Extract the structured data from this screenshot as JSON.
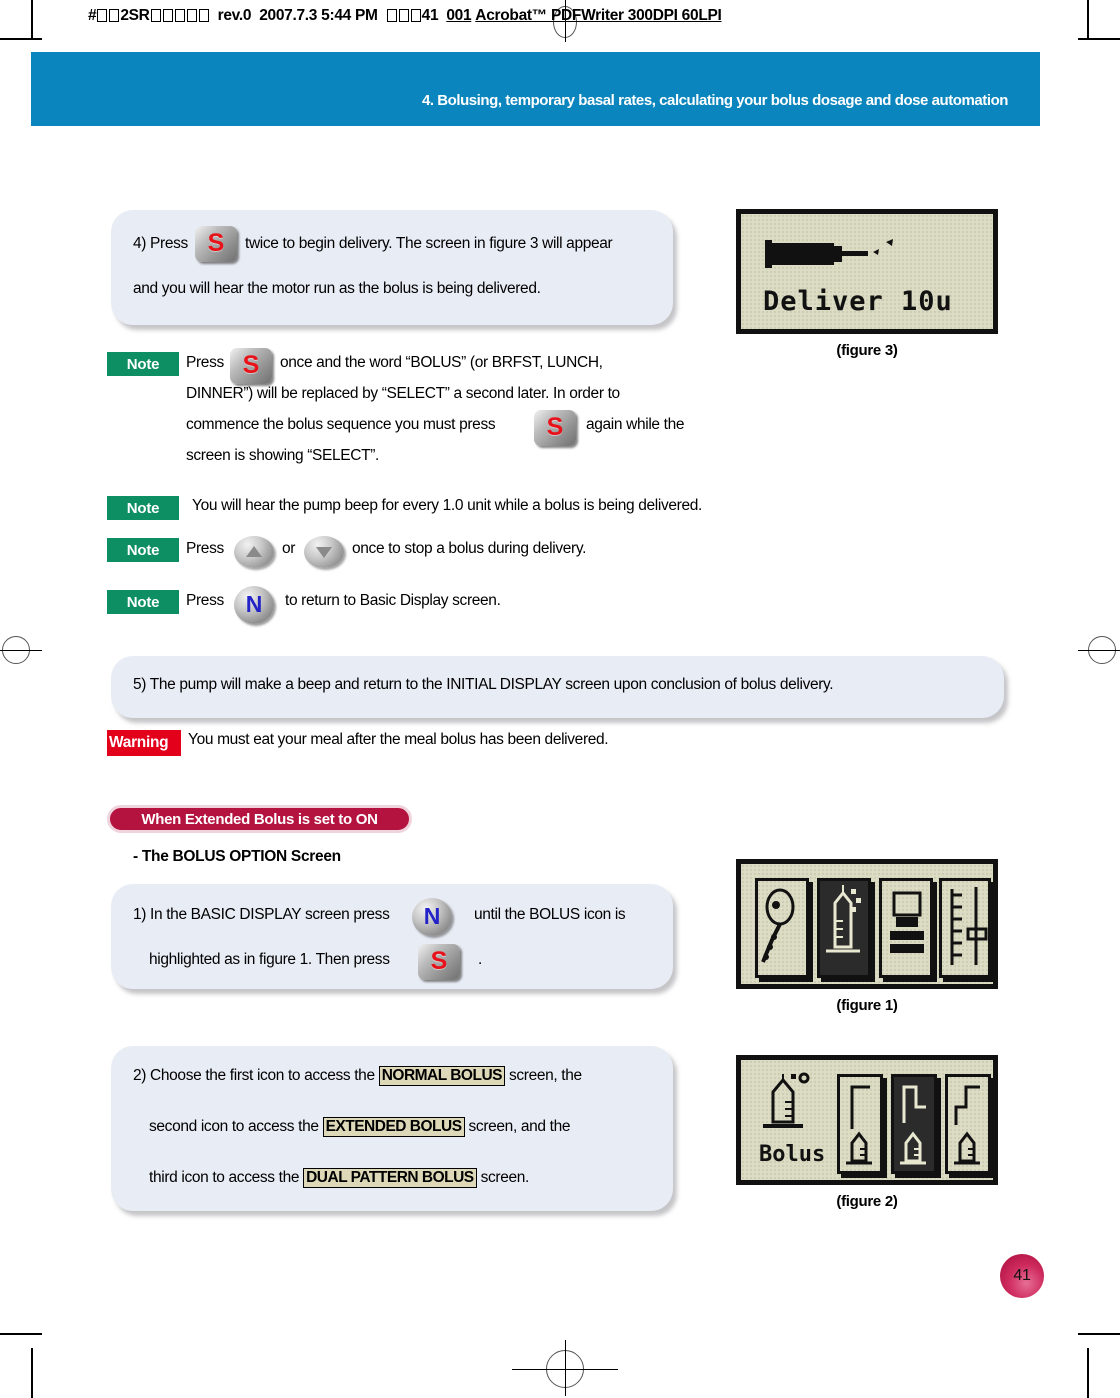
{
  "print_strip": {
    "prefix": "#",
    "doc_code": "2SR",
    "revision": "rev.0",
    "date": "2007.7.3",
    "time": "5:44 PM",
    "page_marker": "41",
    "job": "001",
    "driver": "Acrobat™ PDFWriter 300DPI 60LPI",
    "full_text": "#  2SR      rev.0  2007.7.3 5:44 PM    41   001 Acrobat™ PDFWriter 300DPI 60LPI"
  },
  "banner": {
    "title": "4. Bolusing, temporary basal rates, calculating your bolus dosage and dose automation",
    "color": "#0a85bd"
  },
  "colors": {
    "banner_blue": "#0a85bd",
    "note_green": "#0d8f63",
    "warning_red": "#e2001a",
    "section_crimson": "#b4123f",
    "callout_bg": "#e8ecf5",
    "term_highlight": "#ddd9b8",
    "lcd_bg": "#dcdcc4",
    "button_s_letter": "#e8121a",
    "button_n_letter": "#2323c8"
  },
  "buttons": {
    "s_label": "S",
    "n_label": "N",
    "up_label": "up-arrow",
    "down_label": "down-arrow"
  },
  "step4": {
    "line1_a": "4) Press",
    "line1_b": "twice to begin delivery. The screen in figure 3 will appear",
    "line2": "and you will hear the motor run as the bolus is being delivered."
  },
  "notes": [
    {
      "badge": "Note",
      "line1_a": "Press",
      "line1_b": "once and the word “BOLUS” (or BRFST, LUNCH,",
      "line2": "DINNER”) will be replaced by “SELECT” a second later. In order to",
      "line3_a": "commence the bolus sequence you must press",
      "line3_b": "again while the",
      "line4": "screen is showing “SELECT”."
    },
    {
      "badge": "Note",
      "line1": "You will hear the pump beep for every 1.0 unit while a bolus is being delivered."
    },
    {
      "badge": "Note",
      "line1_a": "Press",
      "line1_b": "or",
      "line1_c": "once to stop a bolus during delivery."
    },
    {
      "badge": "Note",
      "line1_a": "Press",
      "line1_b": "to return to Basic Display screen."
    }
  ],
  "step5": {
    "line1": "5) The pump will make a beep and return to the INITIAL DISPLAY screen upon conclusion of bolus delivery."
  },
  "warning": {
    "badge": "Warning",
    "text": "You must eat your meal after the meal bolus has been delivered."
  },
  "section": {
    "pill": "When Extended Bolus is set to ON",
    "subhead": "- The BOLUS OPTION Screen"
  },
  "step1": {
    "line1_a": "1) In the BASIC DISPLAY screen press",
    "line1_b": "until the BOLUS icon is",
    "line2_a": "highlighted as in figure 1. Then press",
    "line2_b": "."
  },
  "step2": {
    "line1_a": "2) Choose the first icon to access the",
    "line1_term": "NORMAL BOLUS",
    "line1_b": "screen, the",
    "line2_a": "second icon to access the",
    "line2_term": "EXTENDED BOLUS",
    "line2_b": "screen, and the",
    "line3_a": "third icon to access the",
    "line3_term": "DUAL PATTERN BOLUS",
    "line3_b": "screen."
  },
  "figures": {
    "fig3": {
      "caption": "(figure 3)",
      "lcd_text": "Deliver  10u",
      "icon": "syringe-delivering"
    },
    "fig1": {
      "caption": "(figure 1)",
      "icons": [
        "basal-rate-icon",
        "bolus-syringe-icon",
        "pump-status-icon",
        "reservoir-level-icon"
      ],
      "highlighted_index": 1
    },
    "fig2": {
      "caption": "(figure 2)",
      "lcd_text": "Bolus",
      "icons": [
        "normal-bolus-icon",
        "extended-bolus-icon",
        "dual-pattern-bolus-icon"
      ],
      "highlighted_index": 1
    }
  },
  "page_number": "41"
}
